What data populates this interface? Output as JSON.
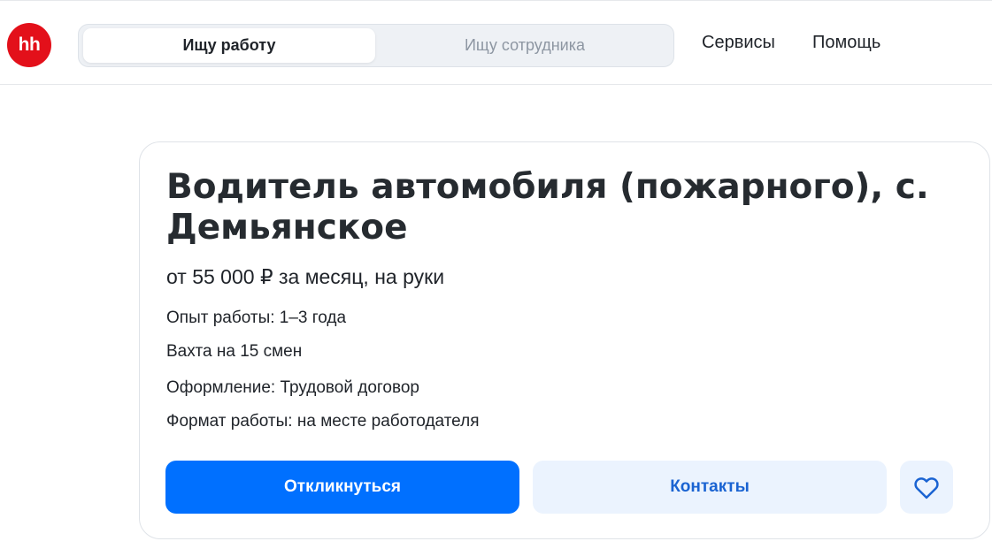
{
  "header": {
    "logo_text": "hh",
    "switcher": {
      "active_label": "Ищу работу",
      "inactive_label": "Ищу сотрудника"
    },
    "nav": {
      "services": "Сервисы",
      "help": "Помощь"
    }
  },
  "vacancy": {
    "title": "Водитель автомобиля (пожарного), с. Демьянское",
    "salary": "от 55 000 ₽ за месяц, на руки",
    "experience": "Опыт работы: 1–3 года",
    "schedule": "Вахта на 15 смен",
    "employment": "Оформление: Трудовой договор",
    "work_format": "Формат работы: на месте работодателя"
  },
  "actions": {
    "respond_label": "Откликнуться",
    "contacts_label": "Контакты",
    "favorite_icon": "heart-icon"
  },
  "colors": {
    "brand": "#e3101a",
    "primary": "#0070ff",
    "secondary_bg": "#ebf3fe",
    "secondary_text": "#1a63d2"
  }
}
